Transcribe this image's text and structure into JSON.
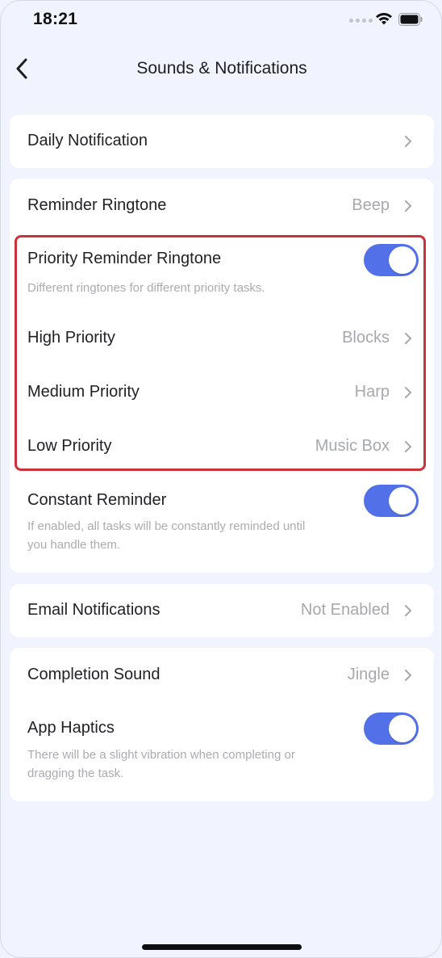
{
  "status_bar": {
    "time": "18:21"
  },
  "nav": {
    "title": "Sounds & Notifications",
    "back_icon": "chevron-left-icon"
  },
  "daily": {
    "label": "Daily Notification"
  },
  "reminder_ringtone": {
    "label": "Reminder Ringtone",
    "value": "Beep"
  },
  "priority": {
    "label": "Priority Reminder Ringtone",
    "enabled": true,
    "desc": "Different ringtones for different priority tasks.",
    "items": [
      {
        "label": "High Priority",
        "value": "Blocks"
      },
      {
        "label": "Medium Priority",
        "value": "Harp"
      },
      {
        "label": "Low Priority",
        "value": "Music Box"
      }
    ]
  },
  "constant": {
    "label": "Constant Reminder",
    "enabled": true,
    "desc_line1": "If enabled, all tasks will be constantly reminded until",
    "desc_line2": "you handle them."
  },
  "email": {
    "label": "Email Notifications",
    "value": "Not Enabled"
  },
  "completion": {
    "label": "Completion Sound",
    "value": "Jingle"
  },
  "haptics": {
    "label": "App Haptics",
    "enabled": true,
    "desc_line1": "There will be a slight vibration when completing or",
    "desc_line2": "dragging the task."
  },
  "colors": {
    "accent": "#5271E9",
    "highlight": "#C9343B",
    "background": "#F1F4FE"
  }
}
